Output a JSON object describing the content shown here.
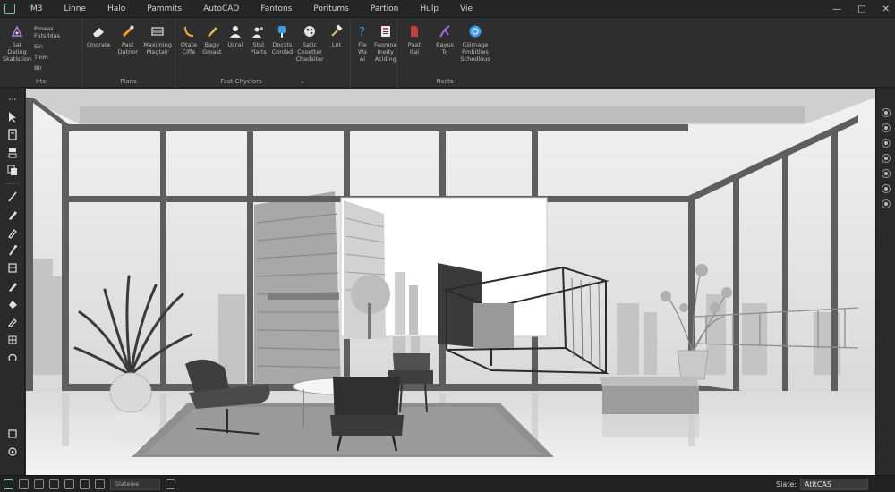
{
  "menu": {
    "items": [
      "M3",
      "Linne",
      "Halo",
      "Pammits",
      "AutoCAD",
      "Fantons",
      "Poritums",
      "Partion",
      "Hulp",
      "Vie"
    ],
    "window_controls": [
      "—",
      "□",
      "✕"
    ]
  },
  "ribbon": {
    "group1": {
      "label": "Irts",
      "buttons": [
        {
          "label": "Sat\nDating\nSkatistion",
          "icon": "pen-tool-icon"
        }
      ],
      "text_items": [
        "Pmeas Futs/Idas",
        "Ein",
        "Tiom",
        "Bir"
      ]
    },
    "group2": {
      "label": "Plans",
      "buttons": [
        {
          "label": "Onorate",
          "icon": "eraser-icon"
        },
        {
          "label": "Past\nDatnor",
          "icon": "brush-icon"
        },
        {
          "label": "Maximing\nMagtair",
          "icon": "panel-icon"
        }
      ]
    },
    "group3": {
      "label": "Fast Chyclors",
      "buttons": [
        {
          "label": "Otate\nCiffe",
          "icon": "arc-icon"
        },
        {
          "label": "Bagy\nGroast",
          "icon": "pencil-icon"
        },
        {
          "label": "Ucral",
          "icon": "user-icon"
        },
        {
          "label": "Stul\nPlarts",
          "icon": "users-icon"
        },
        {
          "label": "Docsts\nCnrdad",
          "icon": "paint-icon"
        },
        {
          "label": "Satic\nCosetter\nChadsiter",
          "icon": "palette-icon"
        },
        {
          "label": "Lnt",
          "icon": "hammer-icon"
        }
      ]
    },
    "group4": {
      "label": "",
      "buttons": [
        {
          "label": "Fle\nWa\nAi",
          "icon": "help-icon"
        },
        {
          "label": "Faomne\nIneity\nAciding",
          "icon": "clipboard-icon"
        }
      ]
    },
    "group5": {
      "label": "Nscts",
      "buttons": [
        {
          "label": "Paat\nItal",
          "icon": "file-red-icon"
        },
        {
          "label": "Bayus\nTo",
          "icon": "curve-icon"
        },
        {
          "label": "Ciiirnage\nPmbitlies\nSchedlous",
          "icon": "globe-icon"
        }
      ]
    }
  },
  "statusbar": {
    "command_placeholder": "Giateiee",
    "status_label": "Siate:",
    "app_field": "AtitCAS"
  },
  "colors": {
    "accent_green": "#7fc6a4",
    "accent_blue": "#3aa0e6",
    "accent_red": "#e05050",
    "accent_purple": "#a070d0"
  }
}
